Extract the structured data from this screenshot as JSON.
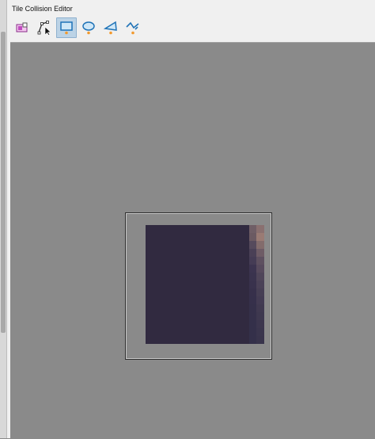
{
  "window": {
    "title": "Tile Collision Editor"
  },
  "toolbar": {
    "buttons": [
      {
        "icon": "collision-properties-icon",
        "active": false
      },
      {
        "icon": "select-edit-icon",
        "active": false
      },
      {
        "icon": "rectangle-icon",
        "active": true
      },
      {
        "icon": "ellipse-icon",
        "active": false
      },
      {
        "icon": "polygon-icon",
        "active": false
      },
      {
        "icon": "polyline-icon",
        "active": false
      }
    ]
  },
  "canvas": {
    "background_color": "#8a8a8a",
    "tile_color": "#312a40",
    "tile_edge_colors": [
      "#6f5e66",
      "#8a7070",
      "#6b5a62",
      "#9a7b74",
      "#564a5c",
      "#836c6c",
      "#4a4056",
      "#6e5c66",
      "#453c55",
      "#5e5060",
      "#3c3450",
      "#574a5d",
      "#3a334e",
      "#4f4559",
      "#39324d",
      "#4a4157",
      "#37304b",
      "#463e54",
      "#36304b",
      "#433b53",
      "#35304a",
      "#403950",
      "#35304a",
      "#3e384f",
      "#34304a",
      "#3c364e",
      "#34304a",
      "#3a354d",
      "#34304a",
      "#39344c"
    ]
  }
}
